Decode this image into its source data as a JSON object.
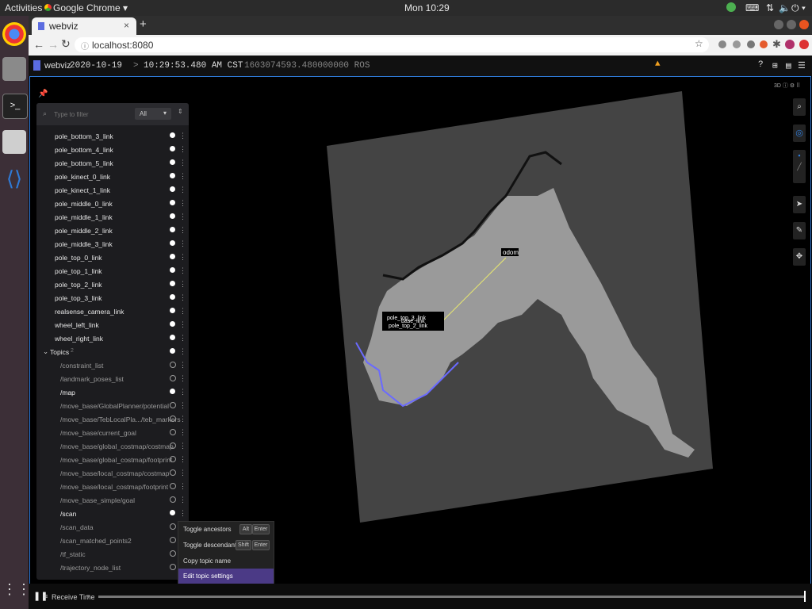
{
  "os": {
    "activities": "Activities",
    "app_name": "Google Chrome",
    "clock": "Mon 10:29"
  },
  "browser": {
    "tab_title": "webviz",
    "url": "localhost:8080"
  },
  "webviz": {
    "brand": "webviz",
    "date": "2020-10-19",
    "time": "10:29:53.480 AM CST",
    "ros_time": "1603074593.480000000 ROS"
  },
  "panel": {
    "filter_placeholder": "Type to filter",
    "filter_select": "All",
    "links": [
      "pole_bottom_3_link",
      "pole_bottom_4_link",
      "pole_bottom_5_link",
      "pole_kinect_0_link",
      "pole_kinect_1_link",
      "pole_middle_0_link",
      "pole_middle_1_link",
      "pole_middle_2_link",
      "pole_middle_3_link",
      "pole_top_0_link",
      "pole_top_1_link",
      "pole_top_2_link",
      "pole_top_3_link",
      "realsense_camera_link",
      "wheel_left_link",
      "wheel_right_link"
    ],
    "topics_header": "Topics",
    "topics_count": "2",
    "topics": [
      {
        "name": "/constraint_list",
        "visible": false
      },
      {
        "name": "/landmark_poses_list",
        "visible": false
      },
      {
        "name": "/map",
        "visible": true
      },
      {
        "name": "/move_base/GlobalPlanner/potential",
        "visible": false
      },
      {
        "name": "/move_base/TebLocalPla.../teb_markers",
        "visible": false
      },
      {
        "name": "/move_base/current_goal",
        "visible": false
      },
      {
        "name": "/move_base/global_costmap/costmap",
        "visible": false
      },
      {
        "name": "/move_base/global_costmap/footprint",
        "visible": false
      },
      {
        "name": "/move_base/local_costmap/costmap",
        "visible": false
      },
      {
        "name": "/move_base/local_costmap/footprint",
        "visible": false
      },
      {
        "name": "/move_base_simple/goal",
        "visible": false
      },
      {
        "name": "/scan",
        "visible": true
      },
      {
        "name": "/scan_data",
        "visible": false
      },
      {
        "name": "/scan_matched_points2",
        "visible": false
      },
      {
        "name": "/tf_static",
        "visible": false
      },
      {
        "name": "/trajectory_node_list",
        "visible": false
      }
    ]
  },
  "context_menu": {
    "toggle_ancestors": "Toggle ancestors",
    "toggle_descendants": "Toggle descendants",
    "copy_topic_name": "Copy topic name",
    "edit_topic_settings": "Edit topic settings",
    "key_alt": "Alt",
    "key_shift": "Shift",
    "key_enter": "Enter"
  },
  "scene": {
    "odom_label": "odom",
    "base_link_label": "base_link",
    "clutter_labels": [
      "pole_top_3_link",
      "pole_top_2_link"
    ]
  },
  "bottom": {
    "receive_time": "Receive Time"
  },
  "colors": {
    "accent": "#2f7bd8",
    "context_highlight": "#4b3a86",
    "warning": "#f0a020"
  }
}
